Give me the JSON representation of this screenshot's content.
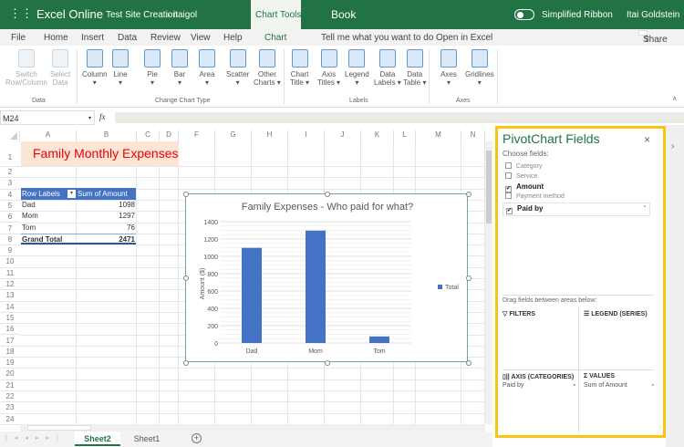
{
  "titlebar": {
    "app": "Excel Online",
    "breadcrumb_site": "Test Site Creation",
    "breadcrumb_sep": "›",
    "breadcrumb_user": "itaigol",
    "context_tab": "Chart Tools",
    "doc": "Book",
    "simplified_ribbon": "Simplified Ribbon",
    "user": "Itai Goldstein"
  },
  "tabs": [
    "File",
    "Home",
    "Insert",
    "Data",
    "Review",
    "View",
    "Help",
    "Chart",
    "Tell me what you want to do",
    "Open in Excel"
  ],
  "share": "Share",
  "ribbon": {
    "data": [
      {
        "l1": "Switch",
        "l2": "Row/Column"
      },
      {
        "l1": "Select",
        "l2": "Data"
      }
    ],
    "charts": [
      {
        "l1": "Column",
        "l2": "▾"
      },
      {
        "l1": "Line",
        "l2": "▾"
      },
      {
        "l1": "Pie",
        "l2": "▾"
      },
      {
        "l1": "Bar",
        "l2": "▾"
      },
      {
        "l1": "Area",
        "l2": "▾"
      },
      {
        "l1": "Scatter",
        "l2": "▾"
      },
      {
        "l1": "Other",
        "l2": "Charts ▾"
      }
    ],
    "labels": [
      {
        "l1": "Chart",
        "l2": "Title ▾"
      },
      {
        "l1": "Axis",
        "l2": "Titles ▾"
      },
      {
        "l1": "Legend",
        "l2": "▾"
      },
      {
        "l1": "Data",
        "l2": "Labels ▾"
      },
      {
        "l1": "Data",
        "l2": "Table ▾"
      }
    ],
    "axes": [
      {
        "l1": "Axes",
        "l2": "▾"
      },
      {
        "l1": "Gridlines",
        "l2": "▾"
      }
    ],
    "groups": [
      "Data",
      "Change Chart Type",
      "Labels",
      "Axes"
    ]
  },
  "formula": {
    "namebox": "M24",
    "fx": "fx",
    "value": ""
  },
  "columns": [
    "A",
    "B",
    "C",
    "D",
    "F",
    "G",
    "H",
    "I",
    "J",
    "K",
    "L",
    "M",
    "N"
  ],
  "rows": [
    "1",
    "2",
    "3",
    "4",
    "5",
    "6",
    "7",
    "8",
    "9",
    "10",
    "11",
    "12",
    "13",
    "14",
    "15",
    "16",
    "17",
    "18",
    "19",
    "20",
    "21",
    "22",
    "23",
    "24"
  ],
  "sheet": {
    "title": "Family Monthly Expenses",
    "pivot": {
      "h1": "Row Labels",
      "h2": "Sum of Amount",
      "rows": [
        {
          "label": "Dad",
          "value": "1098"
        },
        {
          "label": "Mom",
          "value": "1297"
        },
        {
          "label": "Tom",
          "value": "76"
        }
      ],
      "total_label": "Grand Total",
      "total": "2471"
    }
  },
  "chart_data": {
    "type": "bar",
    "title": "Family Expenses - Who paid for what?",
    "categories": [
      "Dad",
      "Mom",
      "Tom"
    ],
    "series": [
      {
        "name": "Total",
        "values": [
          1098,
          1297,
          76
        ],
        "color": "#4472c4"
      }
    ],
    "ylabel": "Amount ($)",
    "xlabel": "",
    "ylim": [
      0,
      1400
    ],
    "yticks": [
      "0",
      "200",
      "400",
      "600",
      "800",
      "1000",
      "1200",
      "1400"
    ],
    "legend": "right",
    "grid": true
  },
  "pane": {
    "title": "PivotChart Fields",
    "close": "×",
    "choose": "Choose fields:",
    "fields": [
      {
        "name": "Category",
        "checked": false
      },
      {
        "name": "Service",
        "checked": false
      },
      {
        "name": "Amount",
        "checked": true
      },
      {
        "name": "Payment method",
        "checked": false
      },
      {
        "name": "Paid by",
        "checked": true
      }
    ],
    "drag": "Drag fields between areas below:",
    "filters": "FILTERS",
    "legend": "LEGEND (SERIES)",
    "axis": "AXIS (CATEGORIES)",
    "values": "VALUES",
    "axis_item": "Paid by",
    "values_item": "Sum of Amount"
  },
  "sheets": [
    "Sheet2",
    "Sheet1"
  ],
  "add_sheet": "+"
}
